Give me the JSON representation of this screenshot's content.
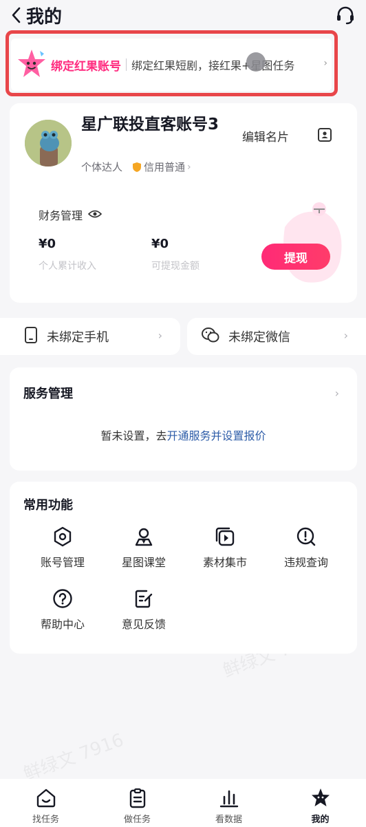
{
  "header": {
    "title": "我的"
  },
  "banner": {
    "title": "绑定红果账号",
    "desc": "绑定红果短剧，接红果+星图任务"
  },
  "profile": {
    "name": "星广联投直客账号3",
    "edit_label": "编辑名片",
    "role": "个体达人",
    "credit": "信用普通"
  },
  "finance": {
    "label": "财务管理",
    "total_income": {
      "value": "¥0",
      "label": "个人累计收入"
    },
    "withdrawable": {
      "value": "¥0",
      "label": "可提现金额"
    },
    "withdraw_button": "提现"
  },
  "bindings": {
    "phone": "未绑定手机",
    "wechat": "未绑定微信"
  },
  "service": {
    "title": "服务管理",
    "empty_prefix": "暂未设置，去",
    "empty_link": "开通服务并设置报价"
  },
  "functions": {
    "title": "常用功能",
    "items": [
      {
        "label": "账号管理",
        "icon": "hexagon-gear-icon"
      },
      {
        "label": "星图课堂",
        "icon": "person-teacher-icon"
      },
      {
        "label": "素材集市",
        "icon": "video-library-icon"
      },
      {
        "label": "违规查询",
        "icon": "alert-search-icon"
      },
      {
        "label": "帮助中心",
        "icon": "help-icon"
      },
      {
        "label": "意见反馈",
        "icon": "feedback-icon"
      }
    ]
  },
  "tabbar": {
    "tabs": [
      {
        "label": "找任务",
        "icon": "home-smile-icon"
      },
      {
        "label": "做任务",
        "icon": "clipboard-icon"
      },
      {
        "label": "看数据",
        "icon": "bar-chart-icon"
      },
      {
        "label": "我的",
        "icon": "star-mascot-icon"
      }
    ]
  },
  "colors": {
    "accent": "#ff2b7f",
    "highlight_border": "#e8464a",
    "link": "#2d5ca8"
  },
  "watermark": "鲜绿文 7916"
}
